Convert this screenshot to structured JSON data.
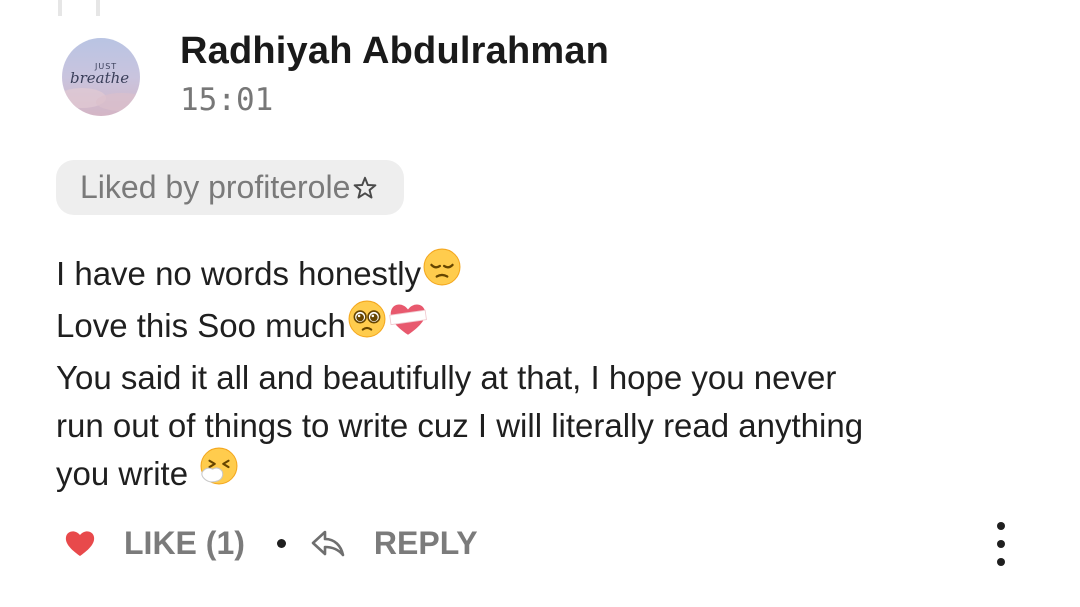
{
  "comment": {
    "author": "Radhiyah Abdulrahman",
    "time": "15:01",
    "avatar_text": {
      "top": "JUST",
      "bottom": "breathe"
    },
    "liked_by_label": "Liked by profiterole",
    "body_lines": [
      "I have no words honestly",
      "Love this Soo much",
      "You said it all and beautifully at that, I hope you never",
      "run out of things to write cuz I will literally read anything",
      "you write "
    ],
    "emojis": {
      "line1": "pensive-face",
      "line2_a": "pleading-face",
      "line2_b": "mending-heart",
      "line5": "sneezing-face"
    }
  },
  "actions": {
    "like_label": "LIKE (1)",
    "reply_label": "REPLY",
    "like_icon": "heart-icon",
    "reply_icon": "reply-icon",
    "more_icon": "more-vertical-icon"
  },
  "colors": {
    "heart": "#e8494b",
    "muted_text": "#7b7b7b",
    "chip_background": "#eeeeee"
  }
}
